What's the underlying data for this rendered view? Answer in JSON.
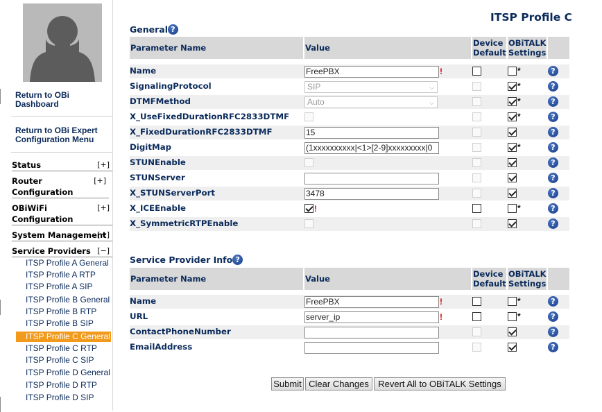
{
  "sidebar": {
    "return_dashboard": "Return to OBi Dashboard",
    "return_expert": "Return to OBi Expert Configuration Menu",
    "sections": [
      {
        "label": "Status",
        "toggle": "[+]"
      },
      {
        "label": "Router Configuration",
        "toggle": "[+]"
      },
      {
        "label": "OBiWiFi Configuration",
        "toggle": "[+]"
      },
      {
        "label": "System Management",
        "toggle": "[+]"
      },
      {
        "label": "Service Providers",
        "toggle": "[−]"
      }
    ],
    "provider_items": [
      "ITSP Profile A General",
      "ITSP Profile A RTP",
      "ITSP Profile A SIP",
      "ITSP Profile B General",
      "ITSP Profile B RTP",
      "ITSP Profile B SIP",
      "ITSP Profile C General",
      "ITSP Profile C RTP",
      "ITSP Profile C SIP",
      "ITSP Profile D General",
      "ITSP Profile D RTP",
      "ITSP Profile D SIP"
    ],
    "active_item": "ITSP Profile C General"
  },
  "page_title": "ITSP Profile C",
  "table_headers": {
    "param": "Parameter Name",
    "value": "Value",
    "device_default_1": "Device",
    "device_default_2": "Default",
    "obitalk_1": "OBiTALK",
    "obitalk_2": "Settings"
  },
  "help_glyph": "?",
  "required_mark": "!",
  "star_mark": "*",
  "general": {
    "title": "General",
    "rows": [
      {
        "name": "Name",
        "value": "FreePBX"
      },
      {
        "name": "SignalingProtocol",
        "value": "SIP"
      },
      {
        "name": "DTMFMethod",
        "value": "Auto"
      },
      {
        "name": "X_UseFixedDurationRFC2833DTMF",
        "value": ""
      },
      {
        "name": "X_FixedDurationRFC2833DTMF",
        "value": "15"
      },
      {
        "name": "DigitMap",
        "value": "(1xxxxxxxxxx|<1>[2-9]xxxxxxxxx|0"
      },
      {
        "name": "STUNEnable",
        "value": ""
      },
      {
        "name": "STUNServer",
        "value": ""
      },
      {
        "name": "X_STUNServerPort",
        "value": "3478"
      },
      {
        "name": "X_ICEEnable",
        "value": ""
      },
      {
        "name": "X_SymmetricRTPEnable",
        "value": ""
      }
    ]
  },
  "provider_info": {
    "title": "Service Provider Info",
    "rows": [
      {
        "name": "Name",
        "value": "FreePBX"
      },
      {
        "name": "URL",
        "value": "server_ip"
      },
      {
        "name": "ContactPhoneNumber",
        "value": ""
      },
      {
        "name": "EmailAddress",
        "value": ""
      }
    ]
  },
  "buttons": {
    "submit": "Submit",
    "clear": "Clear Changes",
    "revert": "Revert All to OBiTALK Settings"
  },
  "colors": {
    "accent": "#f29a1c",
    "text": "#0a2a5a",
    "header_bg": "#d8d8d8",
    "help_icon": "#1d4590"
  }
}
